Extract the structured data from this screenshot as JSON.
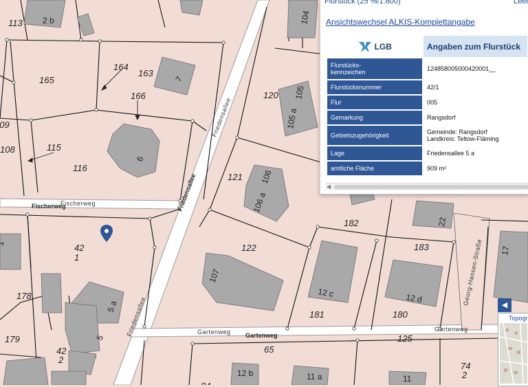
{
  "map": {
    "parcel_labels": [
      "113",
      "164",
      "163",
      "165",
      "166",
      "120",
      "109",
      "108",
      "115",
      "116",
      "121",
      "42",
      "1",
      "182",
      "183",
      "122",
      "178",
      "181",
      "180",
      "179",
      "125",
      "42",
      "2",
      "65",
      "74",
      "2",
      "84"
    ],
    "house_labels": [
      "2 b",
      "104",
      "105 a",
      "105",
      "7",
      "6",
      "106",
      "106 a",
      "22",
      "1",
      "17",
      "107",
      "12 c",
      "12 d",
      "5 a",
      "5",
      "12 b",
      "11 a",
      "11"
    ],
    "street_labels": {
      "friedensallee_top": "Friedensallee",
      "friedensallee_mid": "Friedensallee",
      "friedensallee_low": "Friedensallee",
      "fischerweg": "Fischerweg",
      "fischerweg2": "Fischerweg",
      "gartenweg": "Gartenweg",
      "gartenweg2": "Gartenweg",
      "gartenweg3": "Gartenweg",
      "georg": "Georg-Hansen-Straße"
    },
    "marker_color": "#2f5796"
  },
  "panel": {
    "top_left_partial": "Flurstück (25 %/1:800)",
    "top_right_partial": "Leer",
    "view_link": "Ansichtswechsel ALKIS-Komplettangabe",
    "logo": "LGB",
    "title": "Angaben zum Flurstück",
    "rows": [
      {
        "label": "Flurstücks-\nkennzeichen",
        "value": "124858005000420001__"
      },
      {
        "label": "Flurstücksnummer",
        "value": "42/1"
      },
      {
        "label": "Flur",
        "value": "005"
      },
      {
        "label": "Gemarkung",
        "value": "Rangsdorf"
      },
      {
        "label": "Gebietszugehörigkeit",
        "value": "Gemeinde: Rangsdorf\nLandkreis: Teltow-Fläming"
      },
      {
        "label": "Lage",
        "value": "Friedensallee 5 a"
      },
      {
        "label": "amtliche Fläche",
        "value": "909 m²"
      }
    ],
    "accent": "#2f5796"
  },
  "overview": {
    "toggle": "◀",
    "label": "Topogr"
  }
}
